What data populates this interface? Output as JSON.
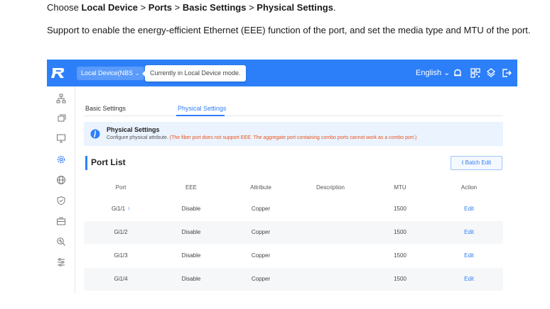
{
  "doc": {
    "choose": "Choose",
    "path_1": "Local Device",
    "sep": ">",
    "path_2": "Ports",
    "path_3": "Basic Settings",
    "path_4": "Physical Settings",
    "period": ".",
    "paragraph": "Support to enable the energy-efficient Ethernet (EEE) function of the port, and set the media type and MTU of the port."
  },
  "topbar": {
    "color": "#2d7ff9",
    "device_button": "Local Device(NBS",
    "tooltip": "Currently in Local Device mode.",
    "language": "English",
    "icons": [
      "bell-icon",
      "qr-code-icon",
      "network-icon",
      "logout-icon"
    ]
  },
  "sidebar": {
    "icons": [
      "topology-icon",
      "devices-icon",
      "monitor-icon",
      "settings-icon",
      "globe-icon",
      "shield-icon",
      "briefcase-icon",
      "diagnostics-icon",
      "sliders-icon"
    ]
  },
  "tabs": [
    "Basic Settings",
    "Physical Settings"
  ],
  "notice": {
    "title": "Physical Settings",
    "desc_prefix": "Configure physical attribute.",
    "desc_warning": "(The fiber port does not support EEE. The aggregate port containing combo ports cannot work as a combo port.)"
  },
  "port_list": {
    "title": "Port List",
    "batch_edit": "Batch Edit",
    "columns": [
      "Port",
      "EEE",
      "Attribute",
      "Description",
      "MTU",
      "Action"
    ],
    "rows": [
      {
        "port": "Gi1/1",
        "uplink": true,
        "eee": "Disable",
        "attribute": "Copper",
        "description": "",
        "mtu": "1500",
        "action": "Edit"
      },
      {
        "port": "Gi1/2",
        "uplink": false,
        "eee": "Disable",
        "attribute": "Copper",
        "description": "",
        "mtu": "1500",
        "action": "Edit"
      },
      {
        "port": "Gi1/3",
        "uplink": false,
        "eee": "Disable",
        "attribute": "Copper",
        "description": "",
        "mtu": "1500",
        "action": "Edit"
      },
      {
        "port": "Gi1/4",
        "uplink": false,
        "eee": "Disable",
        "attribute": "Copper",
        "description": "",
        "mtu": "1500",
        "action": "Edit"
      }
    ]
  }
}
